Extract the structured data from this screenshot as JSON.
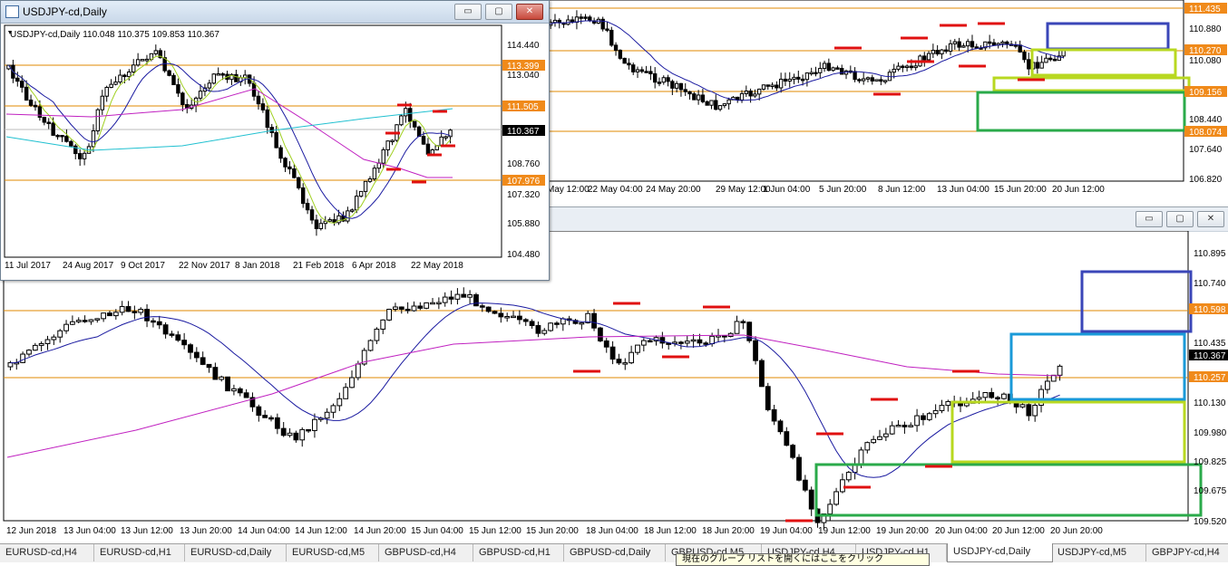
{
  "windows": {
    "h4": {
      "price_labels": [
        "111.435",
        "110.880",
        "110.270",
        "110.080",
        "109.156",
        "108.440",
        "108.074",
        "107.640",
        "106.820"
      ],
      "time_labels": [
        "May 12:00",
        "22 May 04:00",
        "24 May 20:00",
        "29 May 12:00",
        "1 Jun 04:00",
        "5 Jun 20:00",
        "8 Jun 12:00",
        "13 Jun 04:00",
        "15 Jun 20:00",
        "20 Jun 12:00"
      ]
    },
    "m5": {
      "price_labels": [
        "110.895",
        "110.740",
        "110.598",
        "110.435",
        "110.367",
        "110.257",
        "110.130",
        "109.980",
        "109.825",
        "109.675",
        "109.520"
      ],
      "time_labels": [
        "12 Jun 2018",
        "13 Jun 04:00",
        "13 Jun 12:00",
        "13 Jun 20:00",
        "14 Jun 04:00",
        "14 Jun 12:00",
        "14 Jun 20:00",
        "15 Jun 04:00",
        "15 Jun 12:00",
        "15 Jun 20:00",
        "18 Jun 04:00",
        "18 Jun 12:00",
        "18 Jun 20:00",
        "19 Jun 04:00",
        "19 Jun 12:00",
        "19 Jun 20:00",
        "20 Jun 04:00",
        "20 Jun 12:00",
        "20 Jun 20:00"
      ],
      "buttons": {
        "minimize": "▭",
        "maximize": "▢",
        "close": "✕"
      }
    },
    "daily": {
      "title": "USDJPY-cd,Daily",
      "info_line": "USDJPY-cd,Daily  110.048 110.375 109.853 110.367",
      "price_labels": [
        "114.440",
        "113.399",
        "113.040",
        "111.505",
        "110.367",
        "108.760",
        "107.976",
        "107.320",
        "105.880",
        "104.480"
      ],
      "time_labels": [
        "11 Jul 2017",
        "24 Aug 2017",
        "9 Oct 2017",
        "22 Nov 2017",
        "8 Jan 2018",
        "21 Feb 2018",
        "6 Apr 2018",
        "22 May 2018"
      ],
      "buttons": {
        "minimize": "▭",
        "maximize": "▢",
        "close": "✕"
      }
    }
  },
  "tabs": [
    {
      "label": "EURUSD-cd,H4",
      "active": false
    },
    {
      "label": "EURUSD-cd,H1",
      "active": false
    },
    {
      "label": "EURUSD-cd,Daily",
      "active": false
    },
    {
      "label": "EURUSD-cd,M5",
      "active": false
    },
    {
      "label": "GBPUSD-cd,H4",
      "active": false
    },
    {
      "label": "GBPUSD-cd,H1",
      "active": false
    },
    {
      "label": "GBPUSD-cd,Daily",
      "active": false
    },
    {
      "label": "GBPUSD-cd,M5",
      "active": false
    },
    {
      "label": "USDJPY-cd,H4",
      "active": false
    },
    {
      "label": "USDJPY-cd,H1",
      "active": false
    },
    {
      "label": "USDJPY-cd,Daily",
      "active": true
    },
    {
      "label": "USDJPY-cd,M5",
      "active": false
    },
    {
      "label": "GBPJPY-cd,H4",
      "active": false
    }
  ],
  "tooltip": "現在のグループ リストを開くにはここをクリック",
  "colors": {
    "bull": "#000000",
    "bear": "#000000",
    "ma_fast": "#1a1aa0",
    "ma_slow": "#c020c0",
    "ma_daily_200": "#20c0d0",
    "ma_daily_5": "#a0d020",
    "level_line": "#e08a00",
    "resistance_mark": "#e01010",
    "box_blue": "#3a46b8",
    "box_cyan": "#1a9ad8",
    "box_yellowgreen": "#b8d820",
    "box_green": "#2aaa4a",
    "label_orange_bg": "#f08a1a"
  },
  "icons": {
    "chart_window": "chart-window-icon",
    "tab_dropdown": "chevron-down-icon"
  }
}
